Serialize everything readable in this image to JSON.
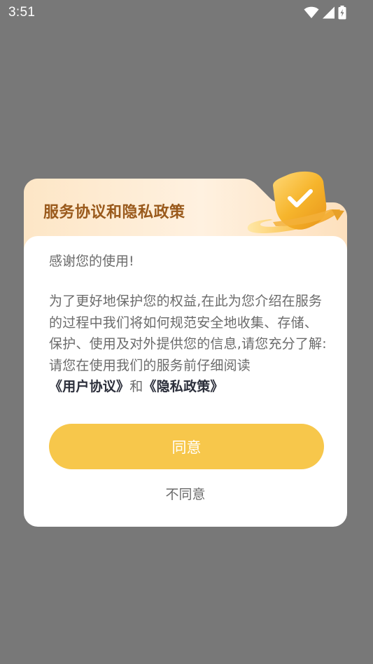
{
  "status_bar": {
    "time": "3:51",
    "icons": [
      "wifi-icon",
      "signal-icon",
      "battery-charging-icon"
    ]
  },
  "dialog": {
    "title": "服务协议和隐私政策",
    "greeting": "感谢您的使用!",
    "paragraph_text": "为了更好地保护您的权益,在此为您介绍在服务的过程中我们将如何规范安全地收集、存储、保护、使用及对外提供您的信息,请您充分了解:请您在使用我们的服务前仔细阅读",
    "user_agreement_link": "《用户协议》",
    "connector": "和",
    "privacy_policy_link": "《隐私政策》",
    "agree_label": "同意",
    "disagree_label": "不同意",
    "colors": {
      "overlay": "#787878",
      "header_gradient_start": "#fde7c7",
      "title": "#9a5a1c",
      "agree_button": "#f7c74b",
      "link_text": "#2b2e3a"
    }
  }
}
